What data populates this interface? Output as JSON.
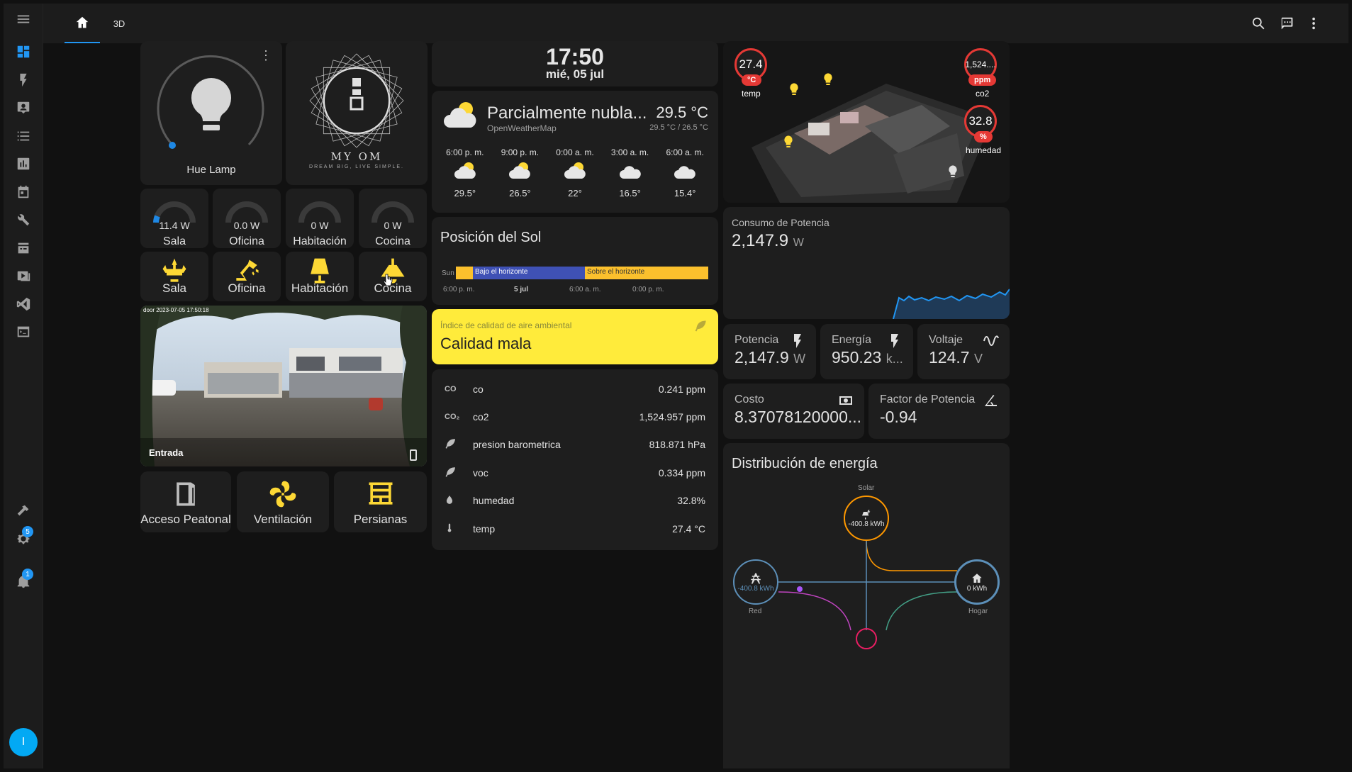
{
  "topbar": {
    "tab_3d": "3D"
  },
  "sidebar": {
    "settings_badge": "5",
    "notifications_badge": "1",
    "user_initial": "I"
  },
  "lamp": {
    "name": "Hue Lamp"
  },
  "logo": {
    "title": "MY OM",
    "tagline": "DREAM BIG, LIVE SIMPLE."
  },
  "power_gauges": [
    {
      "value": "11.4 W",
      "name": "Sala"
    },
    {
      "value": "0.0 W",
      "name": "Oficina"
    },
    {
      "value": "0 W",
      "name": "Habitación"
    },
    {
      "value": "0 W",
      "name": "Cocina"
    }
  ],
  "lights": [
    {
      "name": "Sala",
      "icon": "chandelier-icon"
    },
    {
      "name": "Oficina",
      "icon": "desk-lamp-icon"
    },
    {
      "name": "Habitación",
      "icon": "floor-lamp-icon"
    },
    {
      "name": "Cocina",
      "icon": "ceiling-light-icon"
    }
  ],
  "camera": {
    "name": "Entrada",
    "timestamp": "door 2023-07-05 17:50:18"
  },
  "devices": [
    {
      "name": "Acceso Peatonal",
      "icon": "door-icon"
    },
    {
      "name": "Ventilación",
      "icon": "fan-icon"
    },
    {
      "name": "Persianas",
      "icon": "blinds-icon"
    }
  ],
  "clock": {
    "time": "17:50",
    "date": "mié, 05 jul"
  },
  "weather": {
    "condition": "Parcialmente nubla...",
    "source": "OpenWeatherMap",
    "temp": "29.5 °C",
    "range": "29.5 °C / 26.5 °C",
    "forecast": [
      {
        "time": "6:00 p. m.",
        "temp": "29.5°"
      },
      {
        "time": "9:00 p. m.",
        "temp": "26.5°"
      },
      {
        "time": "0:00 a. m.",
        "temp": "22°"
      },
      {
        "time": "3:00 a. m.",
        "temp": "16.5°"
      },
      {
        "time": "6:00 a. m.",
        "temp": "15.4°"
      }
    ]
  },
  "sun": {
    "title": "Posición del Sol",
    "row_label": "Sun",
    "below": "Bajo el horizonte",
    "above": "Sobre el horizonte",
    "ticks": [
      "6:00 p. m.",
      "5 jul",
      "6:00 a. m.",
      "0:00 p. m."
    ]
  },
  "air_quality": {
    "title": "Índice de calidad de aire ambiental",
    "value": "Calidad mala",
    "color": "#ffeb3b"
  },
  "sensors": [
    {
      "icon": "CO",
      "name": "co",
      "value": "0.241 ppm"
    },
    {
      "icon": "CO₂",
      "name": "co2",
      "value": "1,524.957 ppm"
    },
    {
      "icon": "leaf-icon",
      "name": "presion barometrica",
      "value": "818.871 hPa"
    },
    {
      "icon": "leaf-icon",
      "name": "voc",
      "value": "0.334 ppm"
    },
    {
      "icon": "water-percent-icon",
      "name": "humedad",
      "value": "32.8%"
    },
    {
      "icon": "thermometer-icon",
      "name": "temp",
      "value": "27.4 °C"
    }
  ],
  "floorplan": {
    "temp": {
      "value": "27.4",
      "unit": "°C",
      "label": "temp"
    },
    "co2": {
      "value": "1,524....",
      "unit": "ppm",
      "label": "co2"
    },
    "humidity": {
      "value": "32.8",
      "unit": "%",
      "label": "humedad"
    }
  },
  "consumption": {
    "title": "Consumo de Potencia",
    "value": "2,147.9",
    "unit": "W"
  },
  "tiles": [
    {
      "title": "Potencia",
      "value": "2,147.9",
      "unit": "W",
      "icon": "flash-icon"
    },
    {
      "title": "Energía",
      "value": "950.23",
      "unit": "k...",
      "icon": "flash-icon"
    },
    {
      "title": "Voltaje",
      "value": "124.7",
      "unit": "V",
      "icon": "sine-wave-icon"
    },
    {
      "title": "Costo",
      "value": "8.37078120000...",
      "unit": "",
      "icon": "cash-icon"
    },
    {
      "title": "Factor de Potencia",
      "value": "-0.94",
      "unit": "",
      "icon": "angle-icon"
    }
  ],
  "energy": {
    "title": "Distribución de energía",
    "solar_label": "Solar",
    "solar_value": "-400.8 kWh",
    "grid_label": "Red",
    "grid_value": "-400.8 kWh",
    "home_label": "Hogar",
    "home_value": "0 kWh"
  },
  "colors": {
    "accent": "#2196f3",
    "warning": "#fdd835",
    "danger": "#e53935",
    "solar": "#ff9800",
    "grid": "#5c8fb8"
  }
}
